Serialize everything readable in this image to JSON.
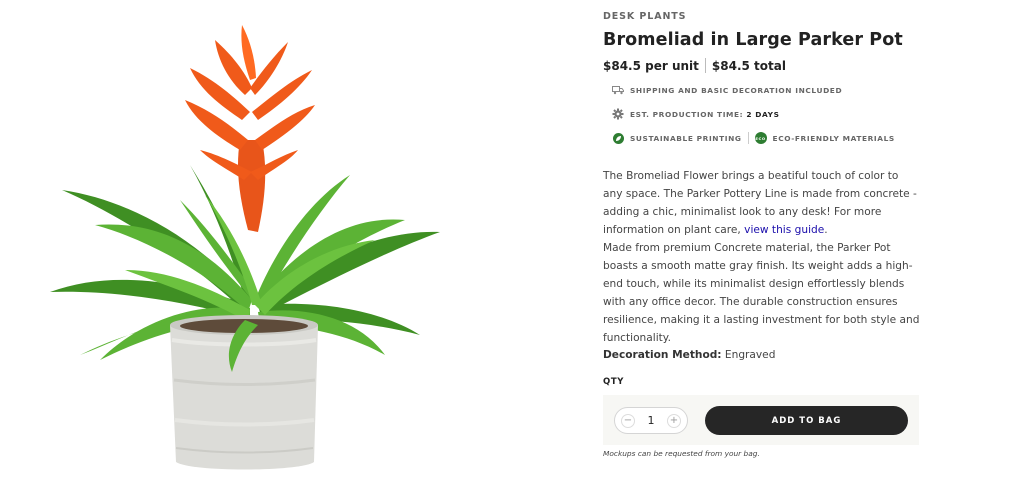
{
  "product": {
    "category": "DESK PLANTS",
    "title": "Bromeliad in Large Parker Pot",
    "price_unit": "$84.5 per unit",
    "price_total": "$84.5 total"
  },
  "features": {
    "shipping": "SHIPPING AND BASIC DECORATION INCLUDED",
    "production_label": "EST. PRODUCTION TIME:",
    "production_value": "2 DAYS",
    "sustainable": "SUSTAINABLE PRINTING",
    "eco": "ECO-FRIENDLY MATERIALS",
    "eco_badge": "ECO"
  },
  "description": {
    "para1": "The Bromeliad Flower brings a beatiful touch of color to any space. The Parker Pottery Line is made from concrete - adding a chic, minimalist look to any desk! For more information on plant care, ",
    "link": "view this guide",
    "para1_end": ".",
    "para2": "Made from premium Concrete material, the Parker Pot boasts a smooth matte gray finish. Its weight adds a high-end touch, while its minimalist design effortlessly blends with any office decor. The durable construction ensures resilience, making it a lasting investment for both style and functionality."
  },
  "decoration": {
    "label": "Decoration Method:",
    "value": "Engraved"
  },
  "purchase": {
    "qty_label": "QTY",
    "qty_value": "1",
    "minus": "−",
    "plus": "+",
    "add_label": "ADD TO BAG",
    "note": "Mockups can be requested from your bag."
  },
  "colors": {
    "button": "#262626",
    "eco_green": "#2e7d32",
    "link": "#1a0dab",
    "flower": "#f05a1a"
  }
}
